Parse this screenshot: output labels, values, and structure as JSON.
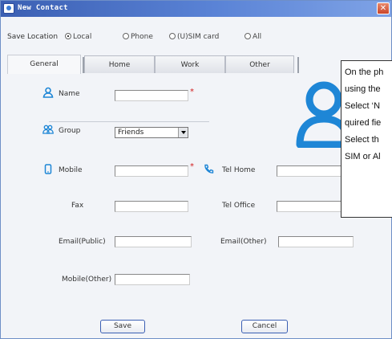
{
  "window": {
    "title": "New Contact",
    "close_glyph": "✕",
    "title_color": "#3b5fb3"
  },
  "save_location": {
    "label": "Save Location",
    "options": [
      {
        "label": "Local",
        "selected": true
      },
      {
        "label": "Phone",
        "selected": false
      },
      {
        "label": "(U)SIM card",
        "selected": false
      },
      {
        "label": "All",
        "selected": false
      }
    ]
  },
  "tabs": [
    {
      "label": "General",
      "active": true
    },
    {
      "label": "Home",
      "active": false
    },
    {
      "label": "Work",
      "active": false
    },
    {
      "label": "Other",
      "active": false
    }
  ],
  "form": {
    "name_label": "Name",
    "group_label": "Group",
    "group_value": "Friends",
    "mobile_label": "Mobile",
    "tel_home_label": "Tel Home",
    "fax_label": "Fax",
    "tel_office_label": "Tel Office",
    "email_public_label": "Email(Public)",
    "email_other_label": "Email(Other)",
    "mobile_other_label": "Mobile(Other)",
    "required_mark": "*"
  },
  "buttons": {
    "save": "Save",
    "cancel": "Cancel"
  },
  "callout": {
    "lines": [
      "On the ph",
      "using the",
      "Select ‘N",
      "quired fie",
      "Select th",
      "SIM or Al"
    ]
  },
  "icons": {
    "contact_silhouette": "contact-photo-icon",
    "accent": "#1e86d6"
  }
}
